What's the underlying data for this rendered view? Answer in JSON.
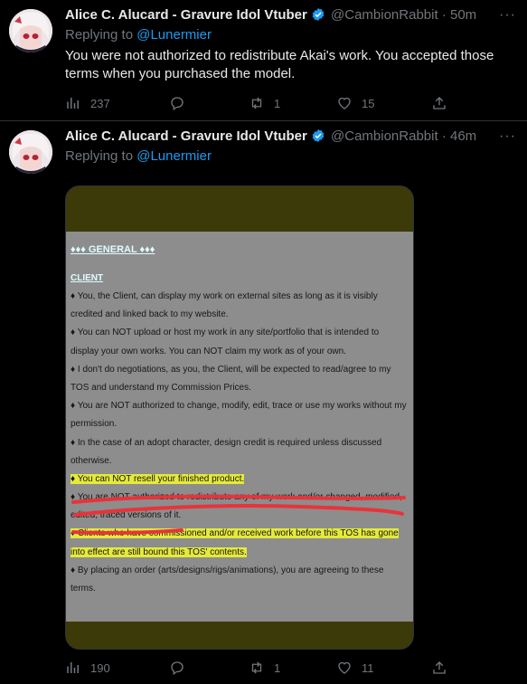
{
  "tweets": [
    {
      "name": "Alice C. Alucard - Gravure Idol Vtuber",
      "handle": "@CambionRabbit",
      "time": "50m",
      "replying_prefix": "Replying to",
      "replying_to": "@Lunermier",
      "text": "You were not authorized to redistribute Akai's work. You accepted those terms when you purchased the model.",
      "views": "237",
      "replies": "",
      "retweets": "1",
      "likes": "15"
    },
    {
      "name": "Alice C. Alucard - Gravure Idol Vtuber",
      "handle": "@CambionRabbit",
      "time": "46m",
      "replying_prefix": "Replying to",
      "replying_to": "@Lunermier",
      "views": "190",
      "replies": "",
      "retweets": "1",
      "likes": "11"
    }
  ],
  "separator": "·",
  "more": "···",
  "document": {
    "heading": "♦♦♦ GENERAL ♦♦♦",
    "subheading": "CLIENT",
    "lines": [
      "♦ You, the Client, can display my work on external sites as long as it is visibly",
      "credited and linked back to my website.",
      "♦ You can NOT upload or host my work in any site/portfolio that is intended to",
      "display your own works. You can NOT claim my work as of your own.",
      "♦ I don't do negotiations, as you, the Client, will be expected to read/agree to my",
      "TOS and understand my Commission Prices.",
      "♦ You are NOT authorized to change, modify, edit, trace or use my works without my",
      "permission.",
      "♦ In the case of an adopt character, design credit is required unless discussed",
      "otherwise.",
      "♦ You can NOT resell your finished product.",
      "♦ You are NOT authorized to redistribute any of my work and/or changed, modified,",
      "edited, traced versions of it.",
      "♦ Clients who have commissioned and/or received work before this TOS has gone",
      "into effect are still bound this TOS' contents.",
      "♦ By placing an order (arts/designs/rigs/animations), you are agreeing to these",
      "terms."
    ]
  },
  "colors": {
    "accent": "#1d9bf0",
    "muted": "#71767b",
    "highlight": "#e5ea3a",
    "redline": "#e8333a"
  }
}
